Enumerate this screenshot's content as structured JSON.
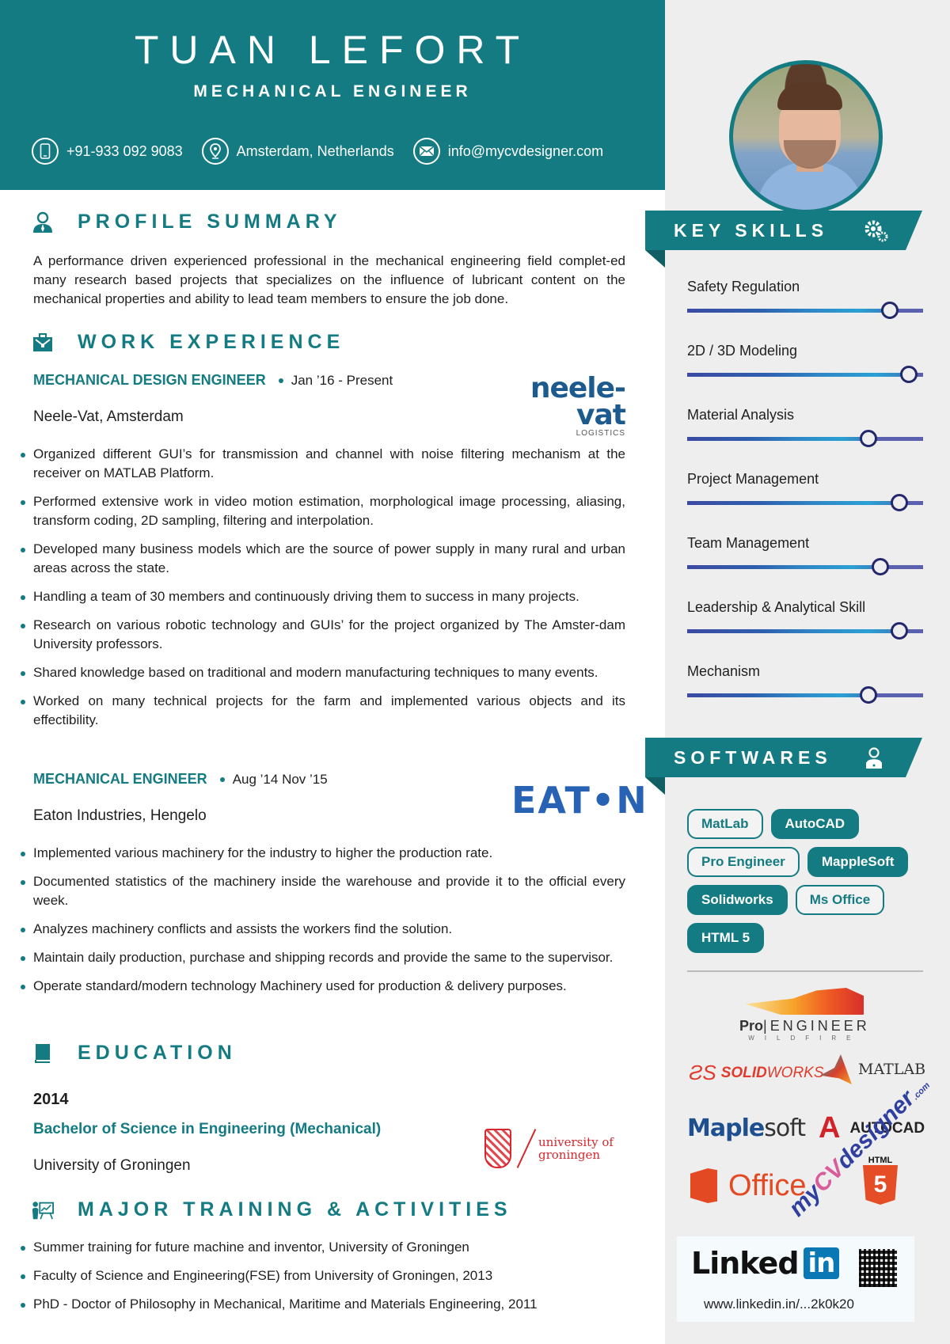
{
  "header": {
    "name": "TUAN LEFORT",
    "role": "MECHANICAL ENGINEER",
    "contacts": [
      {
        "icon": "phone-icon",
        "text": "+91-933 092 9083"
      },
      {
        "icon": "location-pin-icon",
        "text": "Amsterdam, Netherlands"
      },
      {
        "icon": "email-icon",
        "text": "info@mycvdesigner.com"
      }
    ],
    "accent_color": "#157b82"
  },
  "profile": {
    "title": "PROFILE SUMMARY",
    "text": "A performance driven experienced professional in the mechanical engineering field complet-ed many research based projects that specializes on the influence of lubricant content on the mechanical properties and ability to lead team members to ensure the job done."
  },
  "work": {
    "title": "WORK EXPERIENCE",
    "jobs": [
      {
        "title": "MECHANICAL DESIGN ENGINEER",
        "dates": "Jan ’16 - Present",
        "company": "Neele-Vat, Amsterdam",
        "logo": {
          "main": "neele-vat",
          "sub": "LOGISTICS"
        },
        "bullets": [
          "Organized different GUI’s for transmission and channel with noise filtering mechanism at the receiver on MATLAB Platform.",
          "Performed extensive work in video motion estimation, morphological image processing, aliasing, transform coding, 2D sampling, filtering and interpolation.",
          "Developed many business models which are the source of power supply in many rural and urban areas across the state.",
          "Handling a team of 30 members and continuously driving them to success in many projects.",
          "Research on various robotic technology and GUIs’ for the project organized by The Amster-dam University professors.",
          "Shared knowledge based on traditional and modern manufacturing techniques to many events.",
          "Worked on many technical projects for the farm and implemented various objects and its effectibility."
        ]
      },
      {
        "title": "MECHANICAL ENGINEER",
        "dates": "Aug ’14 Nov ’15",
        "company": "Eaton Industries, Hengelo",
        "logo": {
          "main": "EAT•N"
        },
        "bullets": [
          "Implemented various machinery for the industry to higher the production rate.",
          "Documented statistics of the machinery inside the warehouse and provide it to the official every week.",
          "Analyzes machinery conflicts and assists the workers find the solution.",
          "Maintain daily production, purchase and shipping records and provide the same to the supervisor.",
          "Operate standard/modern technology Machinery used for production & delivery purposes."
        ]
      }
    ]
  },
  "education": {
    "title": "EDUCATION",
    "year": "2014",
    "degree": "Bachelor of Science in Engineering (Mechanical)",
    "school": "University of Groningen",
    "logo": {
      "line1": "university of",
      "line2": "groningen"
    }
  },
  "training": {
    "title": "MAJOR TRAINING & ACTIVITIES",
    "items": [
      "Summer training for future machine and inventor, University of Groningen",
      "Faculty of Science and Engineering(FSE) from University of Groningen, 2013",
      "PhD - Doctor of Philosophy in Mechanical, Maritime and Materials Engineering, 2011"
    ]
  },
  "key_skills": {
    "title": "KEY SKILLS",
    "items": [
      {
        "label": "Safety Regulation",
        "level": 0.86
      },
      {
        "label": "2D / 3D Modeling",
        "level": 0.94
      },
      {
        "label": "Material Analysis",
        "level": 0.77
      },
      {
        "label": "Project Management",
        "level": 0.9
      },
      {
        "label": "Team Management",
        "level": 0.82
      },
      {
        "label": "Leadership & Analytical Skill",
        "level": 0.9
      },
      {
        "label": "Mechanism",
        "level": 0.77
      }
    ]
  },
  "softwares": {
    "title": "SOFTWARES",
    "chips": [
      {
        "label": "MatLab",
        "style": "outline"
      },
      {
        "label": "AutoCAD",
        "style": "filled"
      },
      {
        "label": "Pro Engineer",
        "style": "outline"
      },
      {
        "label": "MappleSoft",
        "style": "filled"
      },
      {
        "label": "Solidworks",
        "style": "filled"
      },
      {
        "label": "Ms Office",
        "style": "outline"
      },
      {
        "label": "HTML 5",
        "style": "filled"
      }
    ],
    "logos": {
      "proe_pro": "Pro",
      "proe_eng": "ENGINEER",
      "proe_sub": "WILDFIRE",
      "solidworks_a": "SOLID",
      "solidworks_b": "WORKS",
      "matlab": "MATLAB",
      "maple_a": "Maple",
      "maple_b": "soft",
      "autocad": "AUTOCAD",
      "office": "Office",
      "html_label": "HTML",
      "html_num": "5"
    }
  },
  "linkedin": {
    "brand": "Linked",
    "brand_in": "in",
    "url": "www.linkedin.in/...2k0k20"
  },
  "watermark": {
    "a": "my",
    "b": "CV",
    "c": "designer",
    "d": ".com"
  }
}
